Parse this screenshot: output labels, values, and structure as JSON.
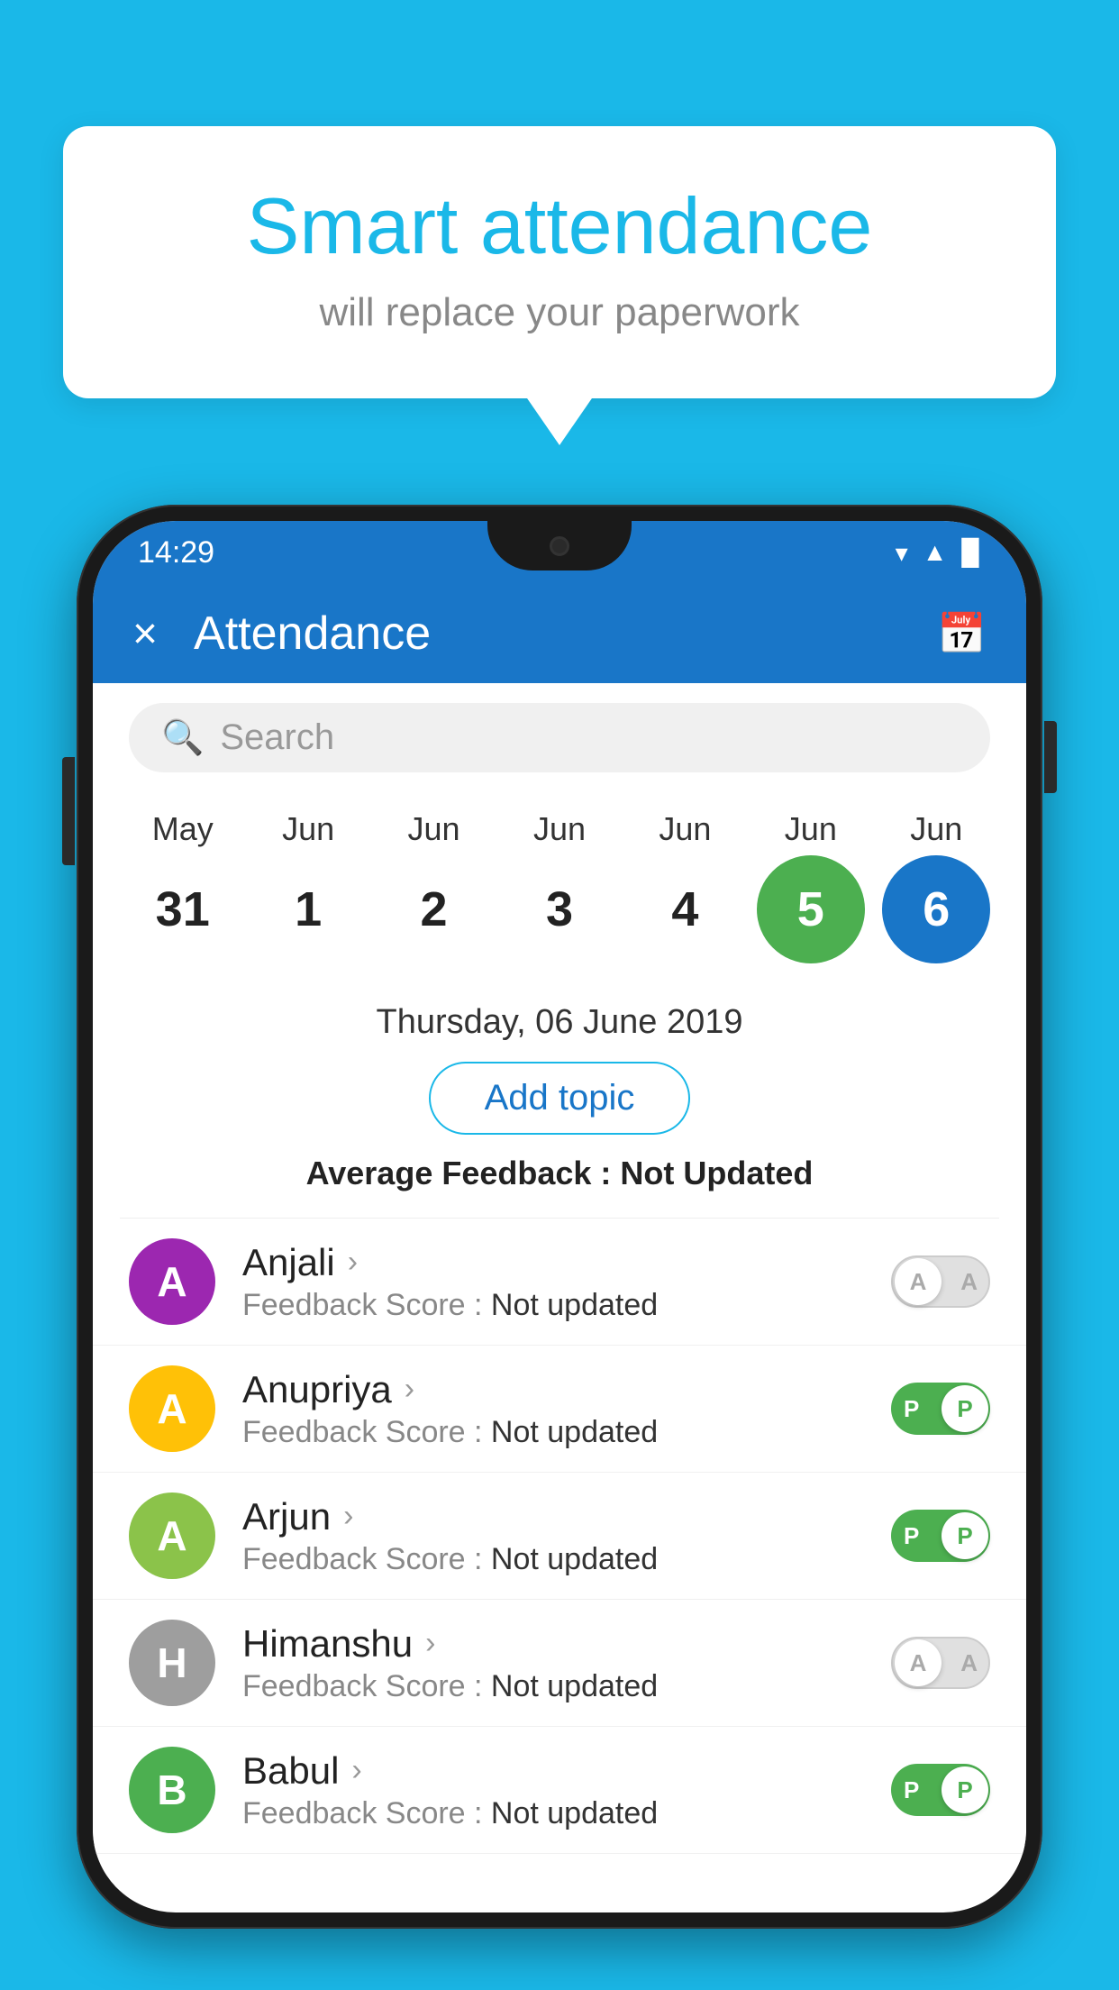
{
  "background_color": "#1ab8e8",
  "bubble": {
    "title": "Smart attendance",
    "subtitle": "will replace your paperwork"
  },
  "status_bar": {
    "time": "14:29",
    "icons": [
      "wifi",
      "signal",
      "battery"
    ]
  },
  "app_bar": {
    "title": "Attendance",
    "close_label": "×",
    "calendar_icon": "📅"
  },
  "search": {
    "placeholder": "Search"
  },
  "calendar": {
    "dates": [
      {
        "month": "May",
        "day": "31",
        "selected": false
      },
      {
        "month": "Jun",
        "day": "1",
        "selected": false
      },
      {
        "month": "Jun",
        "day": "2",
        "selected": false
      },
      {
        "month": "Jun",
        "day": "3",
        "selected": false
      },
      {
        "month": "Jun",
        "day": "4",
        "selected": false
      },
      {
        "month": "Jun",
        "day": "5",
        "selected": "green"
      },
      {
        "month": "Jun",
        "day": "6",
        "selected": "blue"
      }
    ]
  },
  "date_info": {
    "label": "Thursday, 06 June 2019",
    "add_topic_label": "Add topic",
    "avg_feedback_prefix": "Average Feedback : ",
    "avg_feedback_value": "Not Updated"
  },
  "students": [
    {
      "name": "Anjali",
      "avatar_letter": "A",
      "avatar_color": "#9c27b0",
      "feedback": "Feedback Score : ",
      "feedback_value": "Not updated",
      "toggle": "off",
      "toggle_label": "A"
    },
    {
      "name": "Anupriya",
      "avatar_letter": "A",
      "avatar_color": "#ffc107",
      "feedback": "Feedback Score : ",
      "feedback_value": "Not updated",
      "toggle": "on",
      "toggle_label": "P"
    },
    {
      "name": "Arjun",
      "avatar_letter": "A",
      "avatar_color": "#8bc34a",
      "feedback": "Feedback Score : ",
      "feedback_value": "Not updated",
      "toggle": "on",
      "toggle_label": "P"
    },
    {
      "name": "Himanshu",
      "avatar_letter": "H",
      "avatar_color": "#9e9e9e",
      "feedback": "Feedback Score : ",
      "feedback_value": "Not updated",
      "toggle": "off",
      "toggle_label": "A"
    },
    {
      "name": "Babul",
      "avatar_letter": "B",
      "avatar_color": "#4caf50",
      "feedback": "Feedback Score : ",
      "feedback_value": "Not updated",
      "toggle": "on",
      "toggle_label": "P"
    }
  ]
}
